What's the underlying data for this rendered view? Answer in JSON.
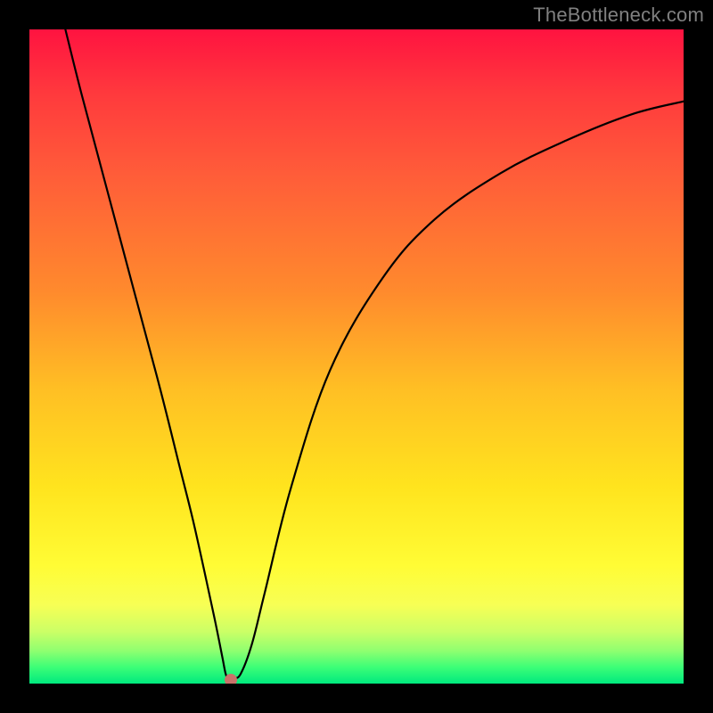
{
  "watermark": "TheBottleneck.com",
  "chart_data": {
    "type": "line",
    "title": "",
    "xlabel": "",
    "ylabel": "",
    "xlim": [
      0,
      100
    ],
    "ylim": [
      0,
      100
    ],
    "gradient_stops": [
      {
        "pos": 0,
        "color": "#ff1340"
      },
      {
        "pos": 10,
        "color": "#ff3a3d"
      },
      {
        "pos": 22,
        "color": "#ff5c39"
      },
      {
        "pos": 40,
        "color": "#ff8a2d"
      },
      {
        "pos": 55,
        "color": "#ffbf24"
      },
      {
        "pos": 70,
        "color": "#ffe41e"
      },
      {
        "pos": 82,
        "color": "#fffc35"
      },
      {
        "pos": 88,
        "color": "#f7ff55"
      },
      {
        "pos": 92,
        "color": "#ccff66"
      },
      {
        "pos": 95,
        "color": "#8fff70"
      },
      {
        "pos": 97.5,
        "color": "#3cfe77"
      },
      {
        "pos": 100,
        "color": "#00e97e"
      }
    ],
    "series": [
      {
        "name": "bottleneck-curve",
        "x": [
          5.5,
          8,
          12,
          16,
          20,
          23,
          25,
          27,
          28.5,
          29.5,
          30,
          30.4,
          31.2,
          32.3,
          34,
          36,
          40,
          46,
          54,
          62,
          72,
          82,
          92,
          100
        ],
        "y": [
          100,
          90,
          75,
          60,
          45,
          33,
          25,
          16,
          9,
          4,
          1.5,
          0.8,
          0.8,
          1.5,
          6,
          14,
          30,
          48,
          62,
          71,
          78,
          83,
          87,
          89
        ]
      }
    ],
    "marker": {
      "x": 30.8,
      "y": 0.6,
      "color": "#c9726a"
    }
  }
}
